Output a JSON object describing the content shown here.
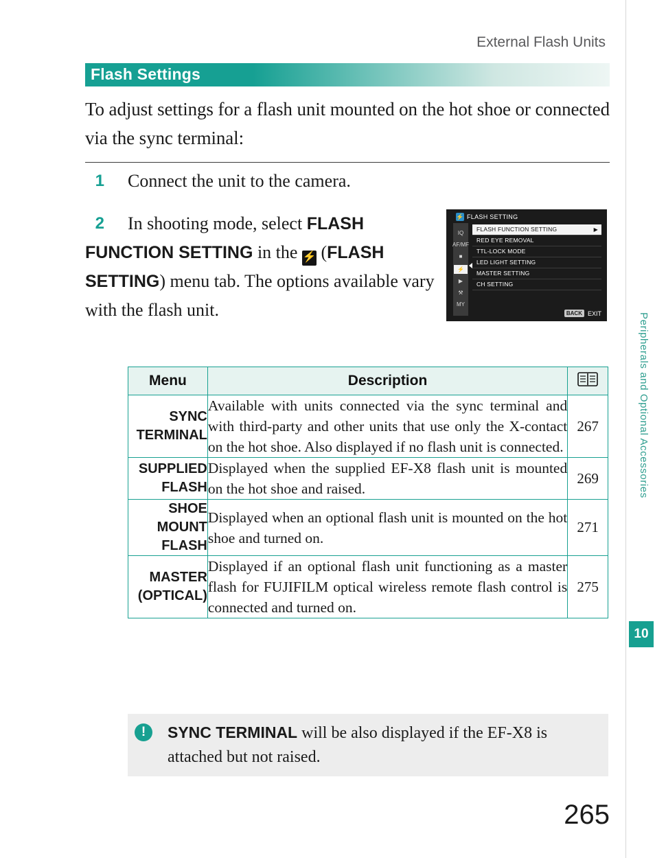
{
  "running_head": "External Flash Units",
  "section": {
    "title": "Flash Settings"
  },
  "intro": "To adjust settings for a flash unit mounted on the hot shoe or connected via the sync terminal:",
  "steps": [
    {
      "num": "1",
      "text": "Connect the unit to the camera."
    },
    {
      "num": "2",
      "text_1": "In shooting mode, select ",
      "bold_1": "FLASH FUNCTION SETTING",
      "text_2": " in the ",
      "icon": "flash-icon",
      "text_3": " (",
      "bold_2": "FLASH SETTING",
      "text_4": ") menu tab. The options available vary with the flash unit."
    }
  ],
  "lcd": {
    "title": "FLASH SETTING",
    "title_icon": "flash-icon",
    "sidebar": [
      {
        "label": "IQ",
        "selected": false
      },
      {
        "label": "AF/MF",
        "selected": false
      },
      {
        "label": "■",
        "selected": false
      },
      {
        "label": "⚡",
        "selected": true
      },
      {
        "label": "▶",
        "selected": false
      },
      {
        "label": "⚒",
        "selected": false
      },
      {
        "label": "MY",
        "selected": false
      }
    ],
    "rows": [
      {
        "label": "FLASH FUNCTION SETTING",
        "selected": true,
        "arrow": "▶"
      },
      {
        "label": "RED EYE REMOVAL",
        "selected": false,
        "arrow": ""
      },
      {
        "label": "TTL-LOCK MODE",
        "selected": false,
        "arrow": ""
      },
      {
        "label": "LED LIGHT SETTING",
        "selected": false,
        "arrow": ""
      },
      {
        "label": "MASTER SETTING",
        "selected": false,
        "arrow": ""
      },
      {
        "label": "CH SETTING",
        "selected": false,
        "arrow": ""
      }
    ],
    "footer": {
      "back": "BACK",
      "exit": "EXIT"
    }
  },
  "table": {
    "headers": {
      "menu": "Menu",
      "description": "Description",
      "page": "book-icon"
    },
    "rows": [
      {
        "menu": "SYNC TERMINAL",
        "description": "Available with units connected via the sync terminal and with third-party and other units that use only the X-contact on the hot shoe. Also displayed if no flash unit is connected.",
        "page": "267"
      },
      {
        "menu": "SUPPLIED FLASH",
        "description": "Displayed when the supplied EF-X8 flash unit is mounted on the hot shoe and raised.",
        "page": "269"
      },
      {
        "menu": "SHOE MOUNT FLASH",
        "description": "Displayed when an optional flash unit is mounted on the hot shoe and turned on.",
        "page": "271"
      },
      {
        "menu": "MASTER (OPTICAL)",
        "description": "Displayed if an optional flash unit functioning as a master flash for FUJIFILM optical wireless remote flash control is connected and turned on.",
        "page": "275"
      }
    ]
  },
  "note": {
    "icon": "!",
    "bold": "SYNC TERMINAL",
    "text": " will be also displayed if the EF-X8 is attached but not raised."
  },
  "side_tab": {
    "text": "Peripherals and Optional Accessories",
    "chapter": "10",
    "color": "#17a091"
  },
  "folio": "265"
}
